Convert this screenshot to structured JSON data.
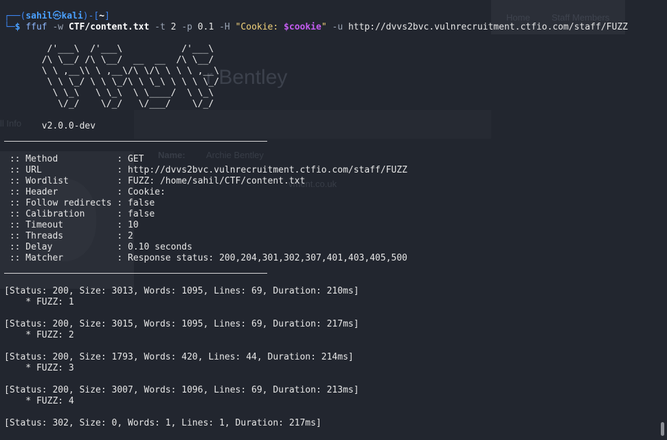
{
  "background_page": {
    "nav": [
      "Home",
      "Staff Members"
    ],
    "title": "r Bentley",
    "tab_label": "ll Info",
    "name_label": "Name:",
    "name_value": "Archie Bentley",
    "email_fragment": "vment.co.uk"
  },
  "prompt": {
    "frame_top": "┌──(",
    "user": "sahil",
    "at_symbol": "㉿",
    "host": "kali",
    "mid": ")-[",
    "dir": "~",
    "end": "]",
    "frame_bottom": "└─",
    "dollar": "$"
  },
  "command": {
    "program": "ffuf",
    "flag_w": "-w",
    "wordlist": "CTF/content.txt",
    "flag_t": "-t",
    "threads": "2",
    "flag_p": "-p",
    "delay": "0.1",
    "flag_H": "-H",
    "header_open": "\"Cookie: ",
    "header_var": "$cookie",
    "header_close": "\"",
    "flag_u": "-u",
    "url": "http://dvvs2bvc.vulnrecruitment.ctfio.com/staff/FUZZ"
  },
  "logo_lines": [
    "        /'___\\  /'___\\           /'___\\",
    "       /\\ \\__/ /\\ \\__/  __  __  /\\ \\__/",
    "       \\ \\ ,__\\\\ \\ ,__\\/\\ \\/\\ \\ \\ \\ ,__\\",
    "        \\ \\ \\_/ \\ \\ \\_/\\ \\ \\_\\ \\ \\ \\ \\_/",
    "         \\ \\_\\   \\ \\_\\  \\ \\____/  \\ \\_\\",
    "          \\/_/    \\/_/   \\/___/    \\/_/"
  ],
  "version": "       v2.0.0-dev",
  "config_lines": [
    " :: Method           : GET",
    " :: URL              : http://dvvs2bvc.vulnrecruitment.ctfio.com/staff/FUZZ",
    " :: Wordlist         : FUZZ: /home/sahil/CTF/content.txt",
    " :: Header           : Cookie: ",
    " :: Follow redirects : false",
    " :: Calibration      : false",
    " :: Timeout          : 10",
    " :: Threads          : 2",
    " :: Delay            : 0.10 seconds",
    " :: Matcher          : Response status: 200,204,301,302,307,401,403,405,500"
  ],
  "results": [
    {
      "status": "[Status: 200, Size: 3013, Words: 1095, Lines: 69, Duration: 210ms]",
      "fuzz": "    * FUZZ: 1"
    },
    {
      "status": "[Status: 200, Size: 3015, Words: 1095, Lines: 69, Duration: 217ms]",
      "fuzz": "    * FUZZ: 2"
    },
    {
      "status": "[Status: 200, Size: 1793, Words: 420, Lines: 44, Duration: 214ms]",
      "fuzz": "    * FUZZ: 3"
    },
    {
      "status": "[Status: 200, Size: 3007, Words: 1096, Lines: 69, Duration: 213ms]",
      "fuzz": "    * FUZZ: 4"
    },
    {
      "status": "[Status: 302, Size: 0, Words: 1, Lines: 1, Duration: 217ms]"
    }
  ],
  "colors": {
    "background": "#22262f",
    "prompt_blue": "#3d86f2",
    "string_yellow": "#f2d27a",
    "variable_purple": "#c35cf0"
  }
}
